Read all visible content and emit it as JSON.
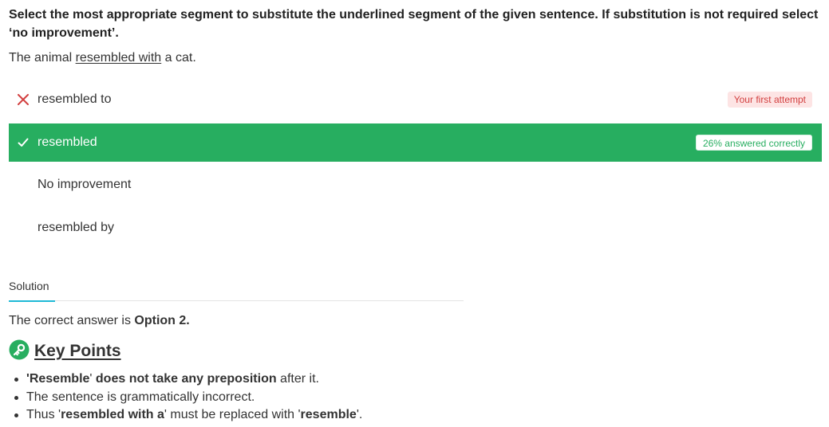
{
  "question": {
    "text": "Select the most appropriate segment to substitute the underlined segment of the given sentence. If substitution is not required select ‘no improvement’."
  },
  "sentence": {
    "before": "The animal ",
    "underlined": "resembled with",
    "after": " a cat."
  },
  "options": [
    {
      "label": "resembled to",
      "state": "wrong",
      "badge": "Your first attempt"
    },
    {
      "label": "resembled",
      "state": "correct",
      "badge": "26% answered correctly"
    },
    {
      "label": "No improvement",
      "state": "none"
    },
    {
      "label": "resembled by",
      "state": "none"
    }
  ],
  "solution": {
    "tab_label": "Solution",
    "answer_prefix": "The correct answer is ",
    "answer_value": "Option 2."
  },
  "key_points": {
    "title": "Key Points",
    "items": [
      {
        "p1": "'",
        "b1": "Resemble",
        "p2": "' ",
        "b2": "does not take any preposition",
        "p3": " after it."
      },
      {
        "text": "The sentence is grammatically incorrect."
      },
      {
        "p1": "Thus '",
        "b1": "resembled with a",
        "p2": "' must be replaced with '",
        "b2": "resemble",
        "p3": "'."
      }
    ]
  },
  "colors": {
    "correct": "#27ae60",
    "wrong": "#d23f3f",
    "tab_accent": "#1fb9d6",
    "key_icon_bg": "#27ae60"
  },
  "icons": {
    "wrong": "close-icon",
    "correct": "check-icon",
    "key_points": "key-icon"
  }
}
